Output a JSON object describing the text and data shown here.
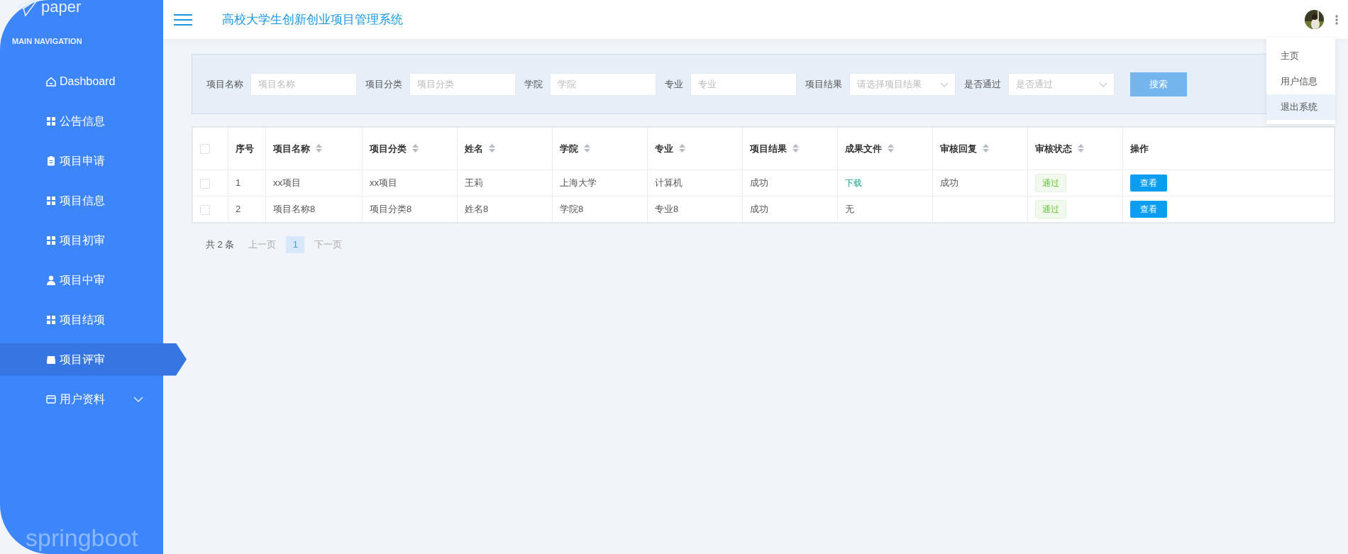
{
  "sidebar": {
    "logo": "paper",
    "section_title": "MAIN NAVIGATION",
    "items": [
      {
        "label": "Dashboard",
        "selected": false
      },
      {
        "label": "公告信息",
        "selected": false
      },
      {
        "label": "项目申请",
        "selected": false
      },
      {
        "label": "项目信息",
        "selected": false
      },
      {
        "label": "项目初审",
        "selected": false
      },
      {
        "label": "项目中审",
        "selected": false
      },
      {
        "label": "项目结项",
        "selected": false
      },
      {
        "label": "项目评审",
        "selected": true
      },
      {
        "label": "用户资料",
        "selected": false,
        "expanded": false
      }
    ],
    "footer": "springboot"
  },
  "header": {
    "title": "高校大学生创新创业项目管理系统"
  },
  "user_menu": {
    "items": [
      {
        "label": "主页",
        "selected": false
      },
      {
        "label": "用户信息",
        "selected": false
      },
      {
        "label": "退出系统",
        "selected": true
      }
    ]
  },
  "filters": [
    {
      "label": "项目名称",
      "placeholder": "项目名称",
      "kind": "text"
    },
    {
      "label": "项目分类",
      "placeholder": "项目分类",
      "kind": "text"
    },
    {
      "label": "学院",
      "placeholder": "学院",
      "kind": "text"
    },
    {
      "label": "专业",
      "placeholder": "专业",
      "kind": "text"
    },
    {
      "label": "项目结果",
      "placeholder": "请选择项目结果",
      "kind": "select"
    },
    {
      "label": "是否通过",
      "placeholder": "是否通过",
      "kind": "select"
    }
  ],
  "search_button": "搜索",
  "table": {
    "all_checked": false,
    "columns": [
      {
        "label": "序号",
        "sortable": false
      },
      {
        "label": "项目名称",
        "sortable": true
      },
      {
        "label": "项目分类",
        "sortable": true
      },
      {
        "label": "姓名",
        "sortable": true
      },
      {
        "label": "学院",
        "sortable": true
      },
      {
        "label": "专业",
        "sortable": true
      },
      {
        "label": "项目结果",
        "sortable": true
      },
      {
        "label": "成果文件",
        "sortable": true
      },
      {
        "label": "审核回复",
        "sortable": true
      },
      {
        "label": "审核状态",
        "sortable": true
      },
      {
        "label": "操作",
        "sortable": false
      }
    ],
    "rows": [
      {
        "checked": false,
        "index": "1",
        "name": "xx项目",
        "category": "xx项目",
        "student": "王莉",
        "college": "上海大学",
        "major": "计算机",
        "result": "成功",
        "file": {
          "text": "下载",
          "kind": "link"
        },
        "reply": "成功",
        "status": "通过",
        "action": "查看"
      },
      {
        "checked": false,
        "index": "2",
        "name": "项目名称8",
        "category": "项目分类8",
        "student": "姓名8",
        "college": "学院8",
        "major": "专业8",
        "result": "成功",
        "file": {
          "text": "无",
          "kind": "plain"
        },
        "status": "通过",
        "action": "查看"
      }
    ]
  },
  "pagination": {
    "total": "共 2 条",
    "prev": "上一页",
    "pages": [
      {
        "label": "1",
        "selected": true
      }
    ],
    "next": "下一页"
  }
}
